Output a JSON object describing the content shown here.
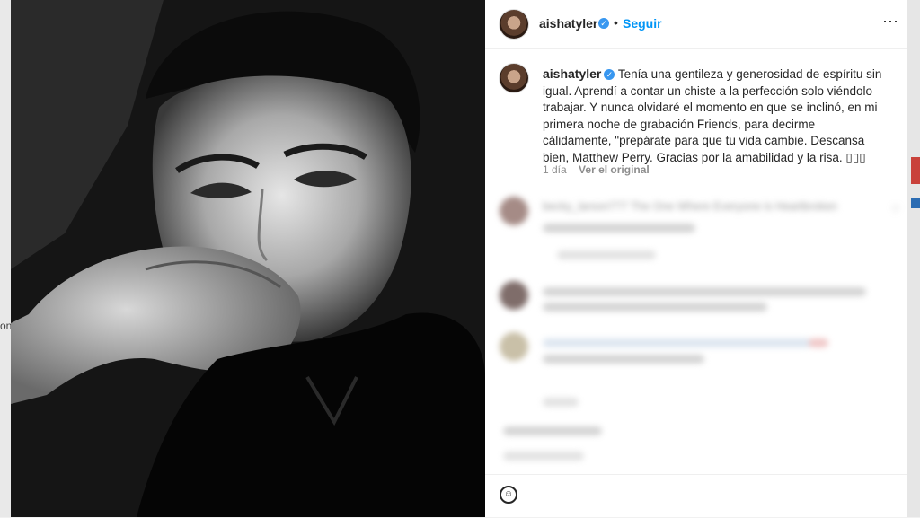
{
  "left_stub": "on",
  "post": {
    "username": "aishatyler",
    "follow_label": "Seguir",
    "more_icon": "more-options-icon",
    "caption_username": "aishatyler",
    "caption": "Tenía una gentileza y generosidad de espíritu sin igual. Aprendí a contar un chiste a la perfección solo viéndolo trabajar. Y nunca olvidaré el momento en que se inclinó, en mi primera noche de grabación Friends, para decirme cálidamente, \"prepárate para que tu vida cambie. Descansa bien, Matthew Perry. Gracias por la amabilidad y la risa. ▯▯▯",
    "time_ago": "1 día",
    "see_original": "Ver el original"
  },
  "comments": {
    "first_text": "becky_larson777 The One Where Everyone is Heartbroken"
  },
  "colors": {
    "link_blue": "#0095f6",
    "verified": "#3897f0",
    "text": "#262626",
    "muted": "#8e8e8e"
  }
}
